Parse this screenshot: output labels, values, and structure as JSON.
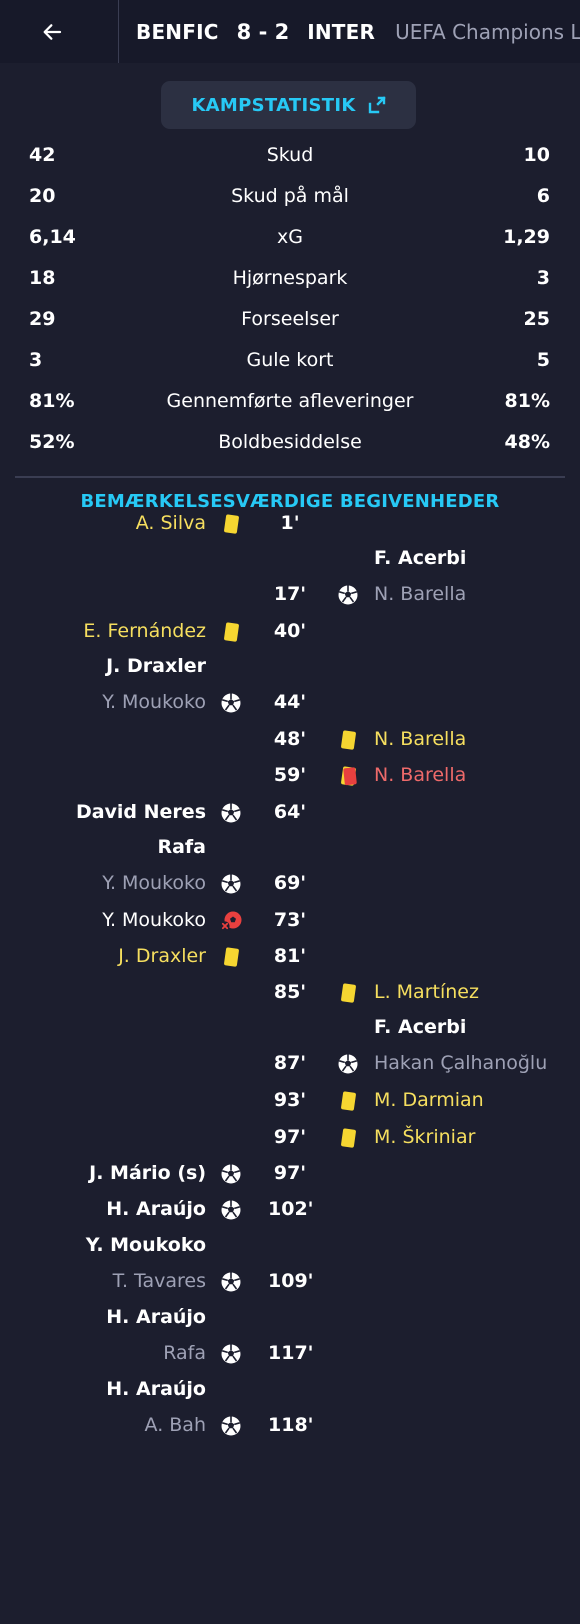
{
  "header": {
    "home": "BENFIC",
    "score": "8 - 2",
    "away": "INTER",
    "competition": "UEFA Champions Le"
  },
  "stats_button": {
    "label": "KAMPSTATISTIK"
  },
  "stats": [
    {
      "left": "42",
      "label": "Skud",
      "right": "10"
    },
    {
      "left": "20",
      "label": "Skud på mål",
      "right": "6"
    },
    {
      "left": "6,14",
      "label": "xG",
      "right": "1,29"
    },
    {
      "left": "18",
      "label": "Hjørnespark",
      "right": "3"
    },
    {
      "left": "29",
      "label": "Forseelser",
      "right": "25"
    },
    {
      "left": "3",
      "label": "Gule kort",
      "right": "5"
    },
    {
      "left": "81%",
      "label": "Gennemførte afleveringer",
      "right": "81%"
    },
    {
      "left": "52%",
      "label": "Boldbesiddelse",
      "right": "48%"
    }
  ],
  "events_title": "BEMÆRKELSESVÆRDIGE BEGIVENHEDER",
  "events": [
    {
      "minute": "1'",
      "side": "home",
      "type": "yellow",
      "player": "A. Silva"
    },
    {
      "minute": "17'",
      "side": "away",
      "type": "goal",
      "player": "F. Acerbi",
      "assist": "N. Barella"
    },
    {
      "minute": "40'",
      "side": "home",
      "type": "yellow",
      "player": "E. Fernández"
    },
    {
      "minute": "44'",
      "side": "home",
      "type": "goal",
      "player": "J. Draxler",
      "assist": "Y. Moukoko"
    },
    {
      "minute": "48'",
      "side": "away",
      "type": "yellow",
      "player": "N. Barella"
    },
    {
      "minute": "59'",
      "side": "away",
      "type": "red",
      "player": "N. Barella"
    },
    {
      "minute": "64'",
      "side": "home",
      "type": "goal",
      "player": "David Neres"
    },
    {
      "minute": "69'",
      "side": "home",
      "type": "goal",
      "player": "Rafa",
      "assist": "Y. Moukoko"
    },
    {
      "minute": "73'",
      "side": "home",
      "type": "missed",
      "player": "Y. Moukoko"
    },
    {
      "minute": "81'",
      "side": "home",
      "type": "yellow",
      "player": "J. Draxler"
    },
    {
      "minute": "85'",
      "side": "away",
      "type": "yellow",
      "player": "L. Martínez"
    },
    {
      "minute": "87'",
      "side": "away",
      "type": "goal",
      "player": "F. Acerbi",
      "assist": "Hakan Çalhanoğlu"
    },
    {
      "minute": "93'",
      "side": "away",
      "type": "yellow",
      "player": "M. Darmian"
    },
    {
      "minute": "97'",
      "side": "away",
      "type": "yellow",
      "player": "M. Škriniar"
    },
    {
      "minute": "97'",
      "side": "home",
      "type": "goal",
      "player": "J. Mário (s)"
    },
    {
      "minute": "102'",
      "side": "home",
      "type": "goal",
      "player": "H. Araújo"
    },
    {
      "minute": "109'",
      "side": "home",
      "type": "goal",
      "player": "Y. Moukoko",
      "assist": "T. Tavares"
    },
    {
      "minute": "117'",
      "side": "home",
      "type": "goal",
      "player": "H. Araújo",
      "assist": "Rafa"
    },
    {
      "minute": "118'",
      "side": "home",
      "type": "goal",
      "player": "H. Araújo",
      "assist": "A. Bah"
    }
  ],
  "colors": {
    "background": "#1c1e2e",
    "header": "#171929",
    "accent": "#27c9f5",
    "yellow_card": "#f6d631",
    "red_card": "#e8403f",
    "muted_text": "#9ea1b5"
  },
  "icons": {
    "back": "arrow-left-icon",
    "expand": "expand-icon",
    "goal": "soccer-ball-icon",
    "yellow": "yellow-card-icon",
    "red": "red-card-icon",
    "missed": "missed-penalty-icon"
  }
}
